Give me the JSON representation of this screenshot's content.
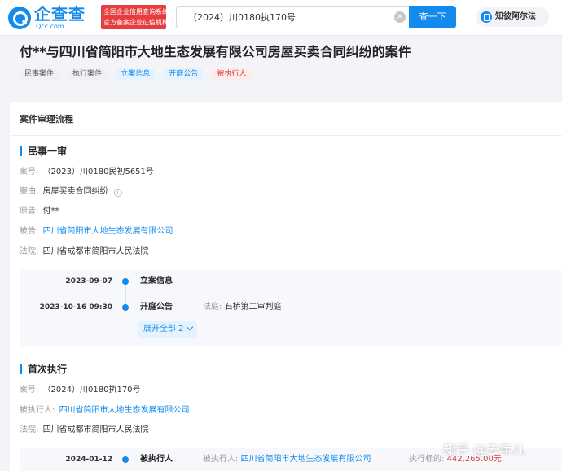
{
  "header": {
    "logo_name": "企查查",
    "logo_domain": "Qcc.com",
    "badge_line1": "全国企业信用查询系统",
    "badge_line2": "官方备案企业征信机构",
    "search_value": "（2024）川0180执170号",
    "search_button": "查一下",
    "zhi_label": "知彼阿尔法"
  },
  "case": {
    "title": "付**与四川省简阳市大地生态发展有限公司房屋买卖合同纠纷的案件",
    "tags": [
      {
        "label": "民事案件"
      },
      {
        "label": "执行案件"
      },
      {
        "label": "立案信息"
      },
      {
        "label": "开庭公告"
      },
      {
        "label": "被执行人"
      }
    ]
  },
  "process": {
    "title": "案件审理流程",
    "first_instance": {
      "title": "民事一审",
      "case_no": {
        "label": "案号:",
        "value": "（2023）川0180民初5651号"
      },
      "cause": {
        "label": "案由:",
        "value": "房屋买卖合同纠纷"
      },
      "plaintiff": {
        "label": "原告:",
        "value": "付**"
      },
      "defendant": {
        "label": "被告:",
        "value": "四川省简阳市大地生态发展有限公司"
      },
      "court": {
        "label": "法院:",
        "value": "四川省成都市简阳市人民法院"
      },
      "timeline": [
        {
          "date": "2023-09-07",
          "name": "立案信息"
        },
        {
          "date": "2023-10-16 09:30",
          "name": "开庭公告",
          "detail_label": "法庭:",
          "detail_value": "石桥第二审判庭"
        }
      ],
      "expand_label": "展开全部 2"
    },
    "first_execution": {
      "title": "首次执行",
      "case_no": {
        "label": "案号:",
        "value": "（2024）川0180执170号"
      },
      "executee": {
        "label": "被执行人:",
        "value": "四川省简阳市大地生态发展有限公司"
      },
      "court": {
        "label": "法院:",
        "value": "四川省成都市简阳市人民法院"
      },
      "timeline": [
        {
          "date": "2024-01-12",
          "name": "被执行人",
          "detail_label": "被执行人:",
          "detail_value": "四川省简阳市大地生态发展有限公司",
          "extra_label": "执行标的:",
          "extra_value": "442,265.00元"
        }
      ]
    }
  },
  "watermark": "知乎 @去年儿",
  "colors": {
    "accent": "#128bed",
    "danger": "#e03c3c",
    "badge": "#e63e3e"
  }
}
